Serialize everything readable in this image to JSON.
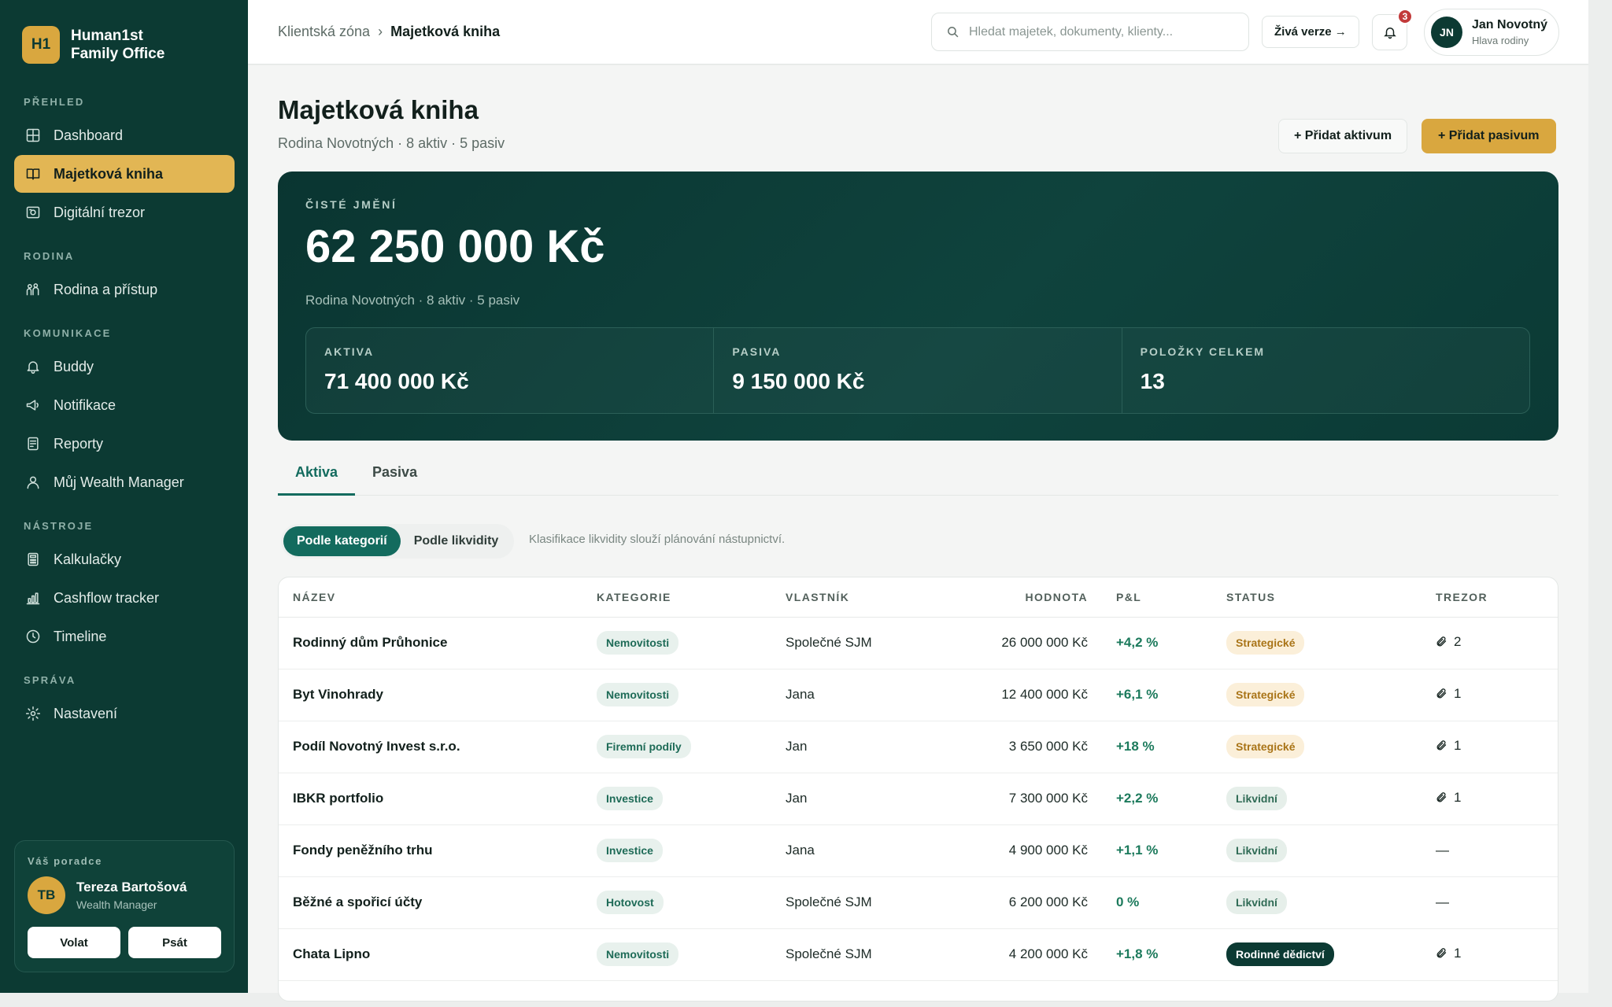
{
  "brand": {
    "logo": "H1",
    "line1": "Human1st",
    "line2": "Family Office"
  },
  "sidebar": {
    "sections": [
      {
        "label": "PŘEHLED",
        "items": [
          {
            "label": "Dashboard",
            "icon": "grid-icon",
            "active": false
          },
          {
            "label": "Majetková kniha",
            "icon": "book-icon",
            "active": true
          },
          {
            "label": "Digitální trezor",
            "icon": "safe-icon",
            "active": false
          }
        ]
      },
      {
        "label": "RODINA",
        "items": [
          {
            "label": "Rodina a přístup",
            "icon": "family-icon",
            "active": false
          }
        ]
      },
      {
        "label": "KOMUNIKACE",
        "items": [
          {
            "label": "Buddy",
            "icon": "bell-icon",
            "active": false
          },
          {
            "label": "Notifikace",
            "icon": "megaphone-icon",
            "active": false
          },
          {
            "label": "Reporty",
            "icon": "report-icon",
            "active": false
          },
          {
            "label": "Můj Wealth Manager",
            "icon": "user-icon",
            "active": false
          }
        ]
      },
      {
        "label": "NÁSTROJE",
        "items": [
          {
            "label": "Kalkulačky",
            "icon": "calculator-icon",
            "active": false
          },
          {
            "label": "Cashflow tracker",
            "icon": "chart-icon",
            "active": false
          },
          {
            "label": "Timeline",
            "icon": "clock-icon",
            "active": false
          }
        ]
      },
      {
        "label": "SPRÁVA",
        "items": [
          {
            "label": "Nastavení",
            "icon": "gear-icon",
            "active": false
          }
        ]
      }
    ]
  },
  "advisor": {
    "label": "Váš poradce",
    "initials": "TB",
    "name": "Tereza Bartošová",
    "role": "Wealth Manager",
    "call_label": "Volat",
    "write_label": "Psát"
  },
  "topbar": {
    "breadcrumb_root": "Klientská zóna",
    "breadcrumb_sep": "›",
    "breadcrumb_current": "Majetková kniha",
    "search_placeholder": "Hledat majetek, dokumenty, klienty...",
    "live_label": "Živá verze →",
    "notification_count": "3",
    "user_initials": "JN",
    "user_name": "Jan Novotný",
    "user_role": "Hlava rodiny"
  },
  "page": {
    "title": "Majetková kniha",
    "subtitle": "Rodina Novotných · 8 aktiv · 5 pasiv",
    "add_asset_label": "+ Přidat aktivum",
    "add_liability_label": "+ Přidat pasivum"
  },
  "hero": {
    "label": "ČISTÉ JMĚNÍ",
    "value": "62 250 000 Kč",
    "subtitle": "Rodina Novotných · 8 aktiv · 5 pasiv",
    "stats": [
      {
        "label": "AKTIVA",
        "value": "71 400 000 Kč"
      },
      {
        "label": "PASIVA",
        "value": "9 150 000 Kč"
      },
      {
        "label": "POLOŽKY CELKEM",
        "value": "13"
      }
    ]
  },
  "tabs": [
    {
      "label": "Aktiva",
      "active": true
    },
    {
      "label": "Pasiva",
      "active": false
    }
  ],
  "segment": {
    "options": [
      {
        "label": "Podle kategorií",
        "active": true
      },
      {
        "label": "Podle likvidity",
        "active": false
      }
    ],
    "note": "Klasifikace likvidity slouží plánování nástupnictví."
  },
  "table": {
    "headers": [
      "NÁZEV",
      "KATEGORIE",
      "VLASTNÍK",
      "HODNOTA",
      "P&L",
      "STATUS",
      "TREZOR"
    ],
    "rows": [
      {
        "name": "Rodinný dům Průhonice",
        "category": "Nemovitosti",
        "owner": "Společné SJM",
        "value": "26 000 000 Kč",
        "pl": "+4,2 %",
        "status": "Strategické",
        "status_type": "strat",
        "vault": "2"
      },
      {
        "name": "Byt Vinohrady",
        "category": "Nemovitosti",
        "owner": "Jana",
        "value": "12 400 000 Kč",
        "pl": "+6,1 %",
        "status": "Strategické",
        "status_type": "strat",
        "vault": "1"
      },
      {
        "name": "Podíl Novotný Invest s.r.o.",
        "category": "Firemní podíly",
        "owner": "Jan",
        "value": "3 650 000 Kč",
        "pl": "+18 %",
        "status": "Strategické",
        "status_type": "strat",
        "vault": "1"
      },
      {
        "name": "IBKR portfolio",
        "category": "Investice",
        "owner": "Jan",
        "value": "7 300 000 Kč",
        "pl": "+2,2 %",
        "status": "Likvidní",
        "status_type": "liq",
        "vault": "1"
      },
      {
        "name": "Fondy peněžního trhu",
        "category": "Investice",
        "owner": "Jana",
        "value": "4 900 000 Kč",
        "pl": "+1,1 %",
        "status": "Likvidní",
        "status_type": "liq",
        "vault": "—"
      },
      {
        "name": "Běžné a spořicí účty",
        "category": "Hotovost",
        "owner": "Společné SJM",
        "value": "6 200 000 Kč",
        "pl": "0 %",
        "status": "Likvidní",
        "status_type": "liq",
        "vault": "—"
      },
      {
        "name": "Chata Lipno",
        "category": "Nemovitosti",
        "owner": "Společné SJM",
        "value": "4 200 000 Kč",
        "pl": "+1,8 %",
        "status": "Rodinné dědictví",
        "status_type": "heritage",
        "vault": "1"
      }
    ]
  },
  "colors": {
    "sidebar": "#0c3a33",
    "accent": "#d9a73f",
    "primary": "#136b5e"
  }
}
